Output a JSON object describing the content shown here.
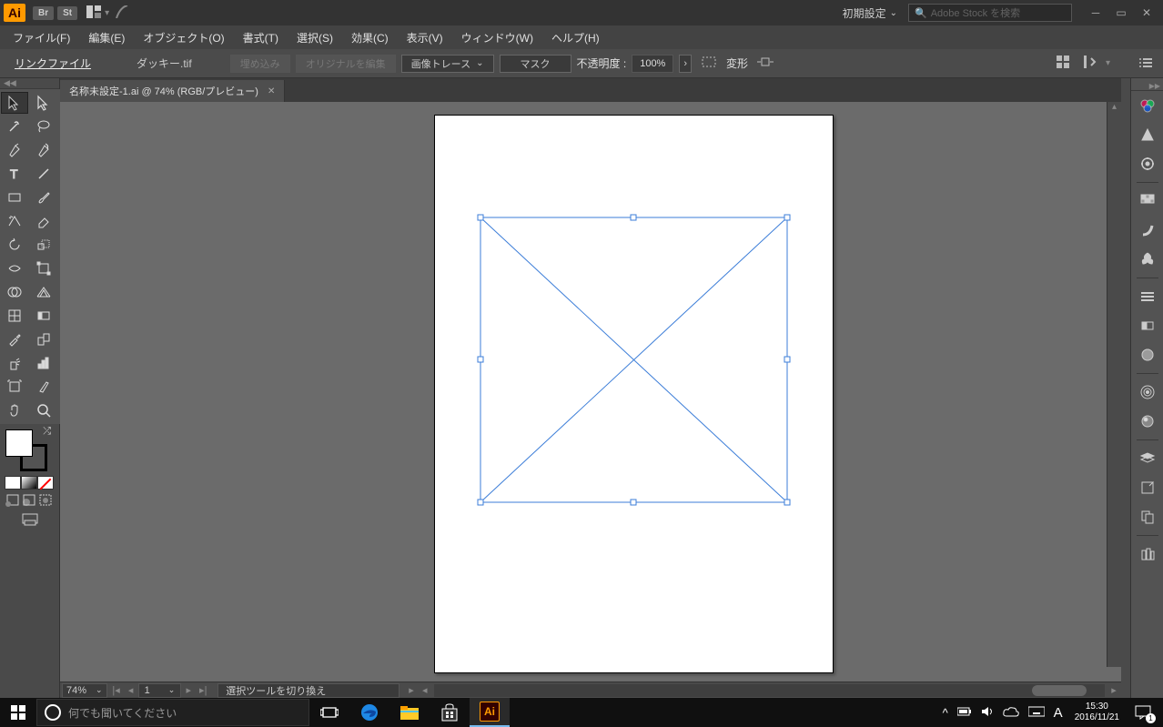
{
  "titlebar": {
    "logo": "Ai",
    "br": "Br",
    "st": "St",
    "workspace": "初期設定",
    "search_placeholder": "Adobe Stock を検索"
  },
  "menu": {
    "file": "ファイル(F)",
    "edit": "編集(E)",
    "object": "オブジェクト(O)",
    "type": "書式(T)",
    "select": "選択(S)",
    "effect": "効果(C)",
    "view": "表示(V)",
    "window": "ウィンドウ(W)",
    "help": "ヘルプ(H)"
  },
  "control": {
    "linkfile": "リンクファイル",
    "filename": "ダッキー.tif",
    "embed": "埋め込み",
    "edit_original": "オリジナルを編集",
    "image_trace": "画像トレース",
    "mask": "マスク",
    "opacity_label": "不透明度 :",
    "opacity_value": "100%",
    "transform": "変形"
  },
  "document": {
    "tab_title": "名称未設定-1.ai @ 74% (RGB/プレビュー)"
  },
  "statusbar": {
    "zoom": "74%",
    "page": "1",
    "message": "選択ツールを切り換え"
  },
  "taskbar": {
    "search_placeholder": "何でも聞いてください",
    "time": "15:30",
    "date": "2016/11/21",
    "ime": "A",
    "notif_count": "1",
    "ai": "Ai"
  }
}
